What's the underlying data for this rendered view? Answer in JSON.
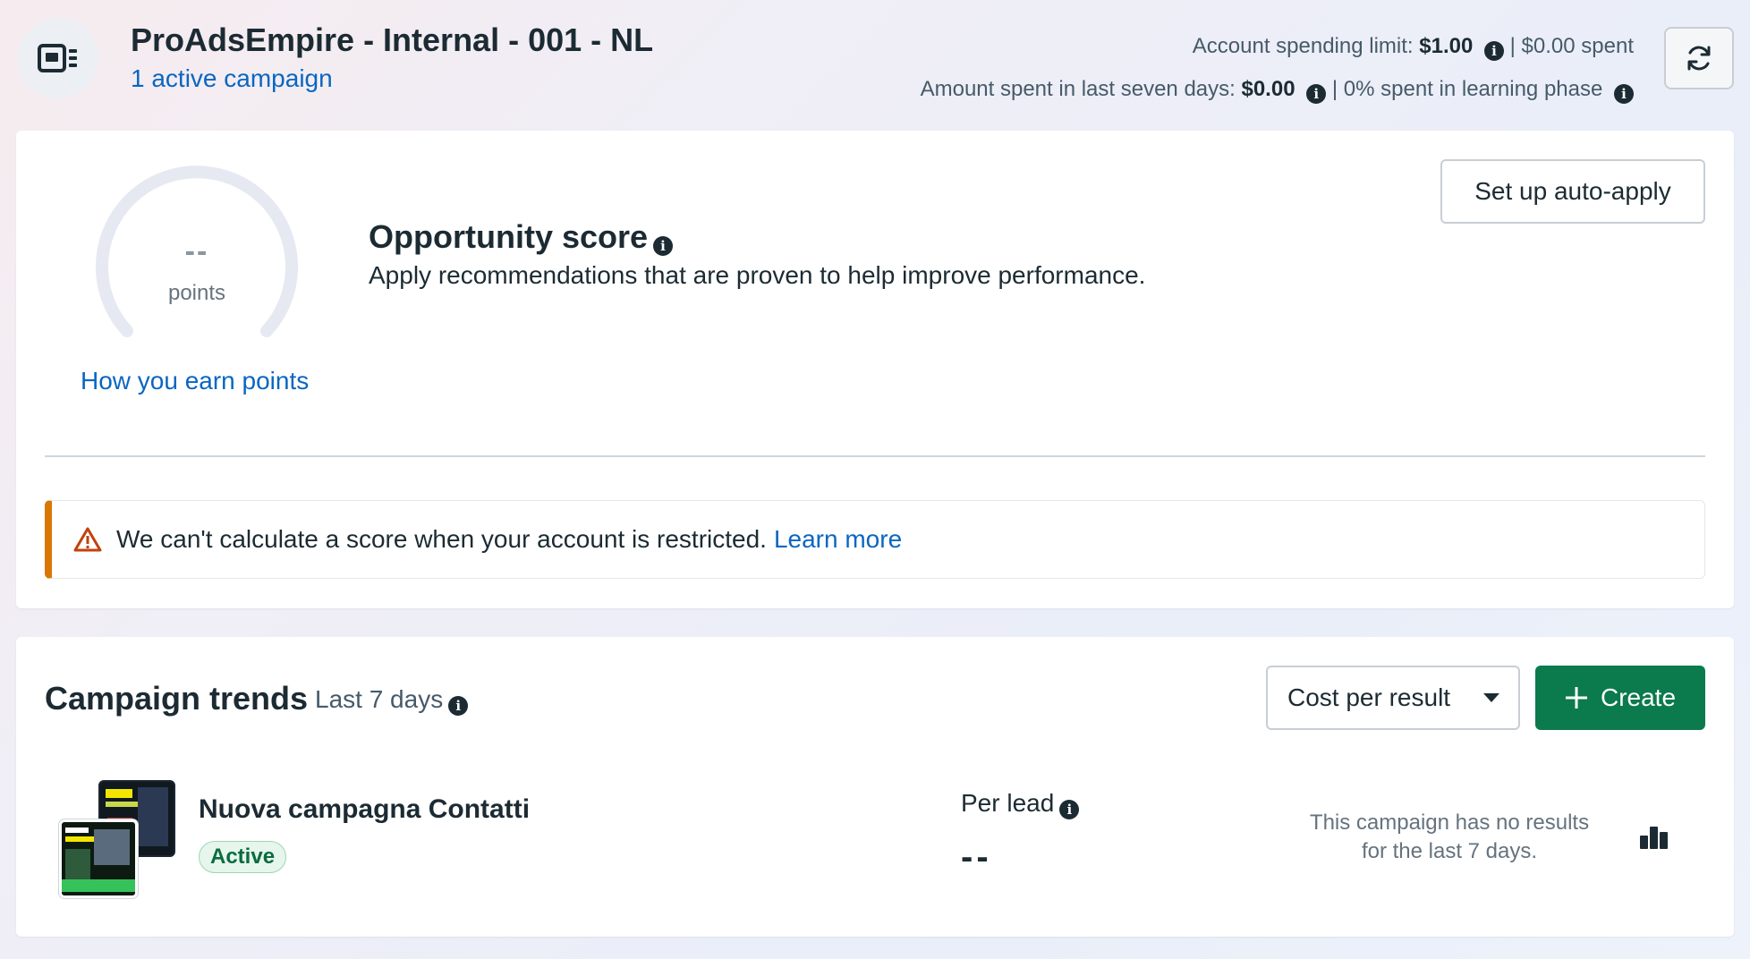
{
  "header": {
    "account_name": "ProAdsEmpire - Internal - 001 - NL",
    "active_campaigns": "1 active campaign",
    "spending_limit_label": "Account spending limit:",
    "spending_limit_value": "$1.00",
    "spent_text": "| $0.00 spent",
    "seven_days_label": "Amount spent in last seven days:",
    "seven_days_value": "$0.00",
    "learning_phase_text": "| 0% spent in learning phase",
    "icons": {
      "account": "ad-account-icon",
      "refresh": "refresh-icon",
      "info": "info-icon"
    }
  },
  "opportunity": {
    "score_value": "--",
    "score_unit": "points",
    "earn_link": "How you earn points",
    "title": "Opportunity score",
    "description": "Apply recommendations that are proven to help improve performance.",
    "auto_apply_label": "Set up auto-apply",
    "alert_text": "We can't calculate a score when your account is restricted.",
    "alert_link": "Learn more",
    "alert_icon": "warning-triangle-icon"
  },
  "trends": {
    "title": "Campaign trends",
    "range": "Last 7 days",
    "metric_selected": "Cost per result",
    "create_label": "Create",
    "campaign": {
      "name": "Nuova campagna Contatti",
      "status": "Active",
      "metric_label": "Per lead",
      "metric_value": "--",
      "no_results_line1": "This campaign has no results",
      "no_results_line2": "for the last 7 days."
    }
  },
  "colors": {
    "link": "#0a66c2",
    "create_button": "#0b7a4d",
    "alert_accent": "#d97706",
    "active_badge_bg": "#e6f6ec",
    "active_badge_text": "#0b6b3f"
  }
}
